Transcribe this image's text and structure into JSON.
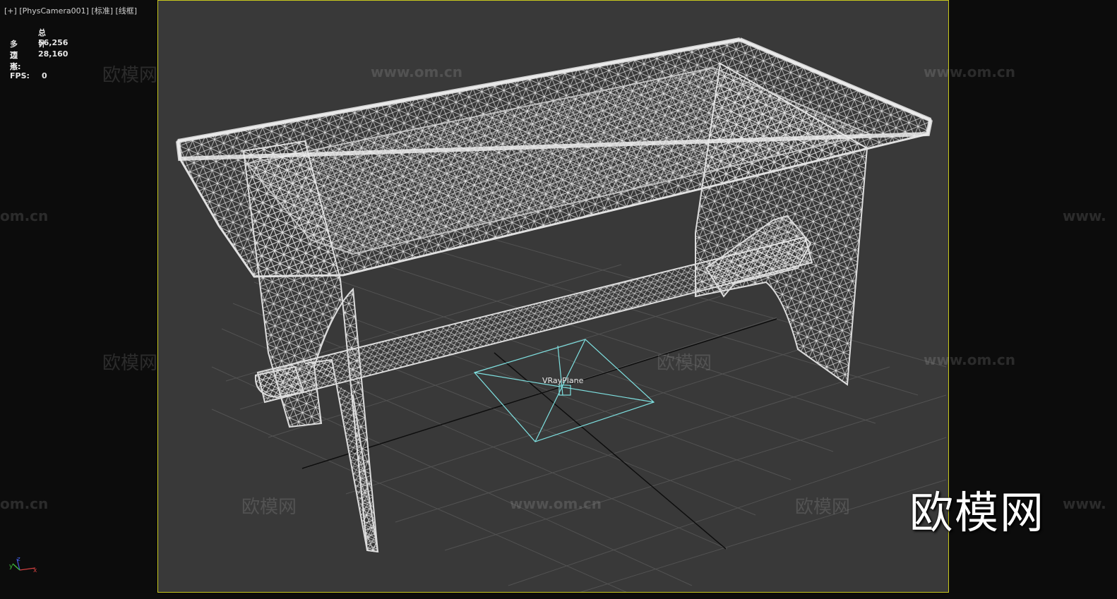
{
  "viewport": {
    "label_parts": [
      "[+]",
      "[PhysCamera001]",
      "[标准]",
      "[线框]"
    ],
    "stats": {
      "header": "总计",
      "polygons_label": "多边形:",
      "polygons_value": "56,256",
      "vertices_label": "顶点:",
      "vertices_value": "28,160",
      "fps_label": "FPS:",
      "fps_value": "0"
    },
    "object_label": "VRayPlane",
    "axis_labels": {
      "x": "x",
      "y": "y",
      "z": "z"
    }
  },
  "watermarks": {
    "brand": "欧模网",
    "url": "www.om.cn",
    "url_partial_left": "om.cn",
    "url_partial_right": "www."
  },
  "colors": {
    "viewport_bg": "#393939",
    "outside_bg": "#0c0c0c",
    "safe_frame": "#c8c81e",
    "wireframe": "#e8e8e8",
    "vray_plane": "#7ee0e0",
    "grid": "#555555"
  },
  "icons": {
    "axis_gizmo": "axis-tripod-icon"
  }
}
